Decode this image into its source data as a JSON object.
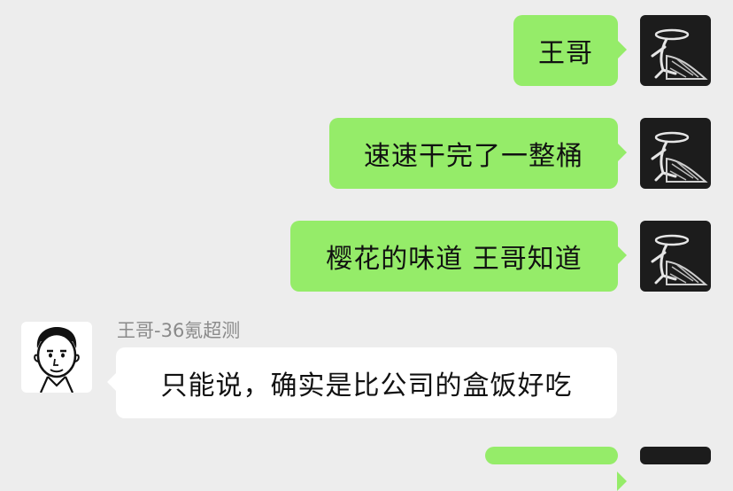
{
  "theme": {
    "background": "#ededed",
    "outgoing_bubble": "#95ec69",
    "incoming_bubble": "#ffffff"
  },
  "messages": [
    {
      "direction": "outgoing",
      "text": "王哥",
      "avatar": "sketch-figure-halo"
    },
    {
      "direction": "outgoing",
      "text": "速速干完了一整桶",
      "avatar": "sketch-figure-halo"
    },
    {
      "direction": "outgoing",
      "text": "樱花的味道 王哥知道",
      "avatar": "sketch-figure-halo"
    },
    {
      "direction": "incoming",
      "sender": "王哥-36氪超测",
      "text": "只能说，确实是比公司的盒饭好吃",
      "avatar": "cartoon-face"
    }
  ]
}
